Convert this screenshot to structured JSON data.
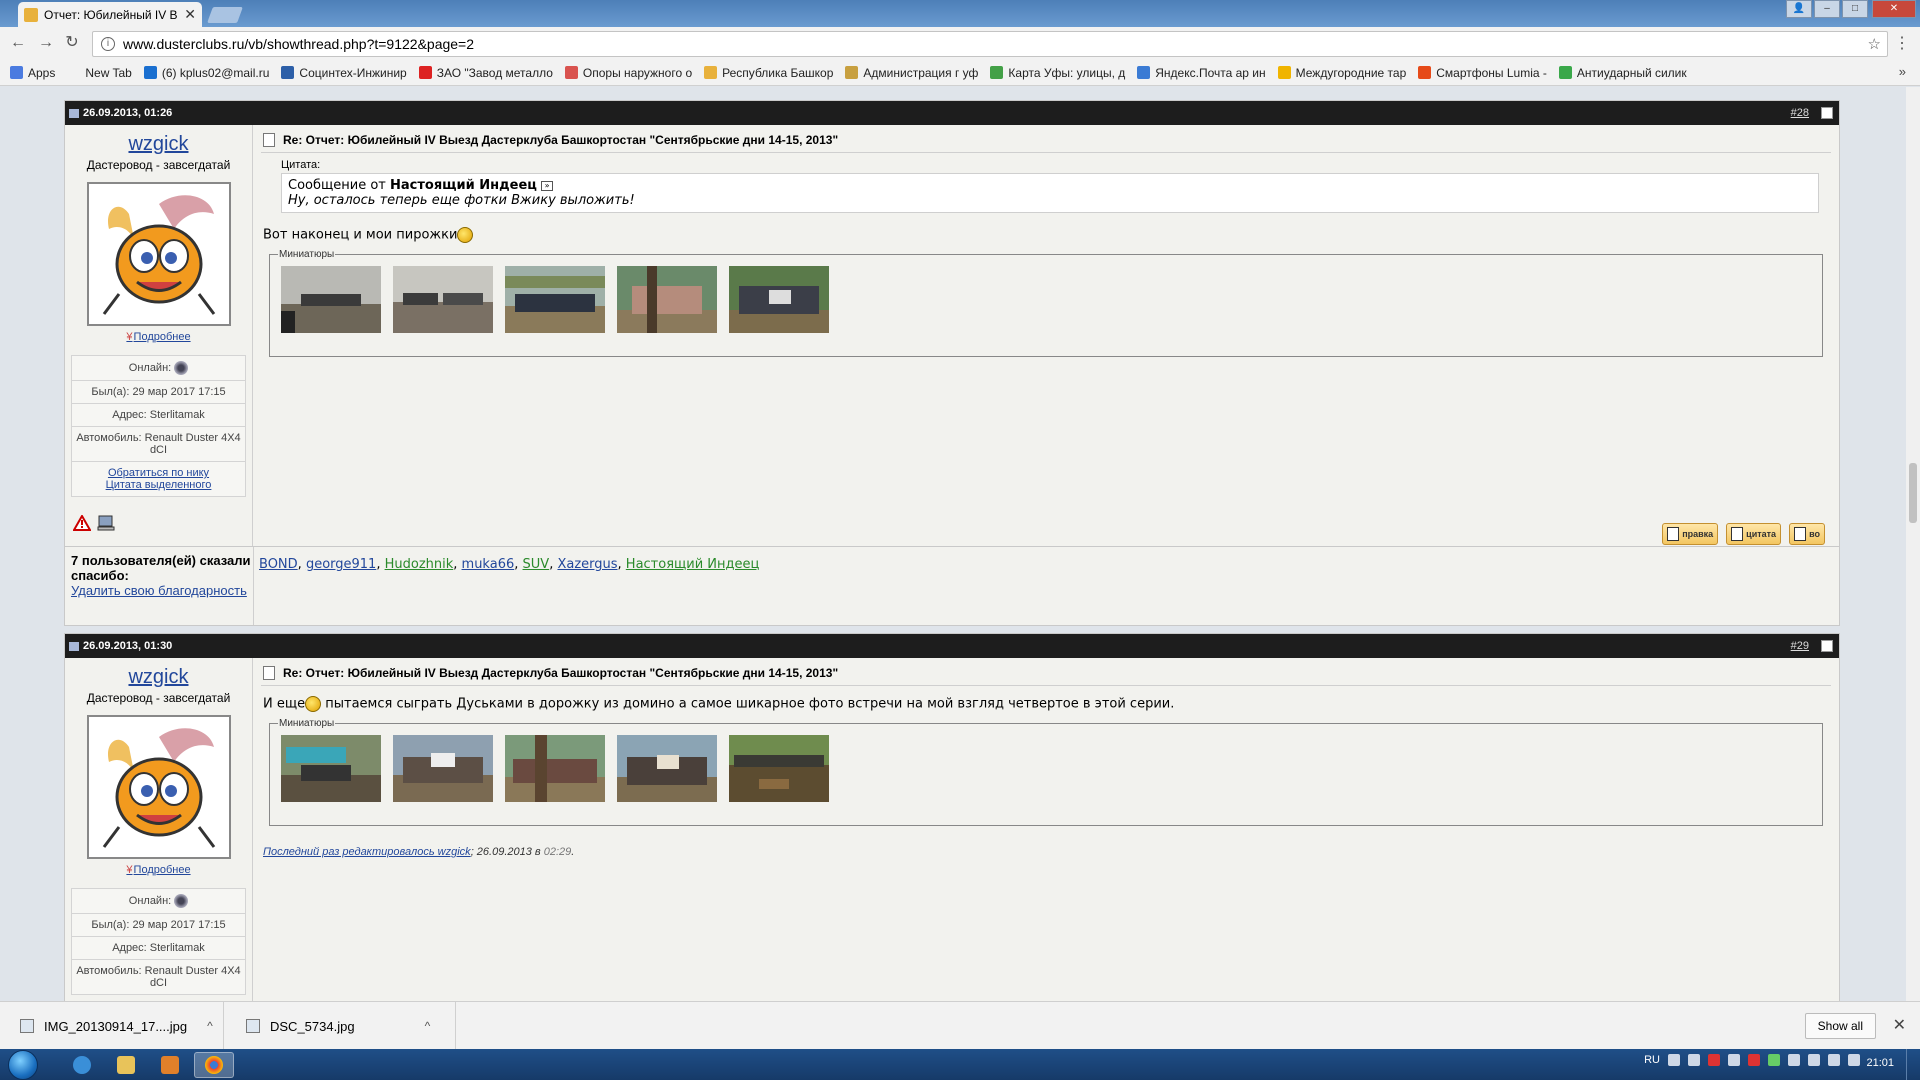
{
  "browser": {
    "tab_title": "Отчет: Юбилейный IV В",
    "url": "www.dusterclubs.ru/vb/showthread.php?t=9122&page=2",
    "bookmarks": [
      {
        "label": "Apps",
        "color": "#4b7be0"
      },
      {
        "label": "New Tab",
        "color": "#f2f2f2"
      },
      {
        "label": "(6) kplus02@mail.ru",
        "color": "#1a6fd0"
      },
      {
        "label": "Социнтех-Инжинир",
        "color": "#2d5fa8"
      },
      {
        "label": "ЗАО \"Завод металло",
        "color": "#d22"
      },
      {
        "label": "Опоры наружного о",
        "color": "#d9534f"
      },
      {
        "label": "Республика Башкор",
        "color": "#e8b13c"
      },
      {
        "label": "Администрация г уф",
        "color": "#c8a040"
      },
      {
        "label": "Карта Уфы: улицы, д",
        "color": "#43a047"
      },
      {
        "label": "Яндекс.Почта ар ин",
        "color": "#3b7bd4"
      },
      {
        "label": "Междугородние тар",
        "color": "#f0b400"
      },
      {
        "label": "Смартфоны Lumia -",
        "color": "#e64a19"
      },
      {
        "label": "Антиударный силик",
        "color": "#3aa84a"
      }
    ]
  },
  "posts": [
    {
      "date": "26.09.2013, 01:26",
      "number": "#28",
      "username": "wzgick",
      "user_title": "Дастеровод - завсегдатай",
      "more_label": "Подробнее",
      "online_label": "Онлайн:",
      "last_seen": "Был(а): 29 мар 2017 17:15",
      "address": "Адрес: Sterlitamak",
      "car": "Автомобиль: Renault Duster 4X4 dCI",
      "link1": "Обратиться по нику",
      "link2": "Цитата выделенного",
      "title": "Re: Отчет: Юбилейный IV Выезд Дастерклуба Башкортостан \"Сентябрьские дни 14-15, 2013\"",
      "quote_label": "Цитата:",
      "quote_prefix": "Сообщение от",
      "quote_author": "Настоящий Индеец",
      "quote_text": "Ну, осталось теперь еще фотки Вжику выложить!",
      "text": "Вот наконец и мои пирожки",
      "thumbs_label": "Миниатюры",
      "actions": [
        "правка",
        "цитата",
        "во"
      ]
    },
    {
      "date": "26.09.2013, 01:30",
      "number": "#29",
      "username": "wzgick",
      "user_title": "Дастеровод - завсегдатай",
      "more_label": "Подробнее",
      "online_label": "Онлайн:",
      "last_seen": "Был(а): 29 мар 2017 17:15",
      "address": "Адрес: Sterlitamak",
      "car": "Автомобиль: Renault Duster 4X4 dCI",
      "title": "Re: Отчет: Юбилейный IV Выезд Дастерклуба Башкортостан \"Сентябрьские дни 14-15, 2013\"",
      "text_before": "И еще",
      "text_after": " пытаемся сыграть Дуськами в дорожку из домино а самое шикарное фото встречи на мой взгляд четвертое в этой серии.",
      "thumbs_label": "Миниатюры",
      "edited_prefix": "Последний раз редактировалось wzgick",
      "edited_date": "; 26.09.2013 в ",
      "edited_time": "02:29",
      "edited_end": "."
    }
  ],
  "thanks": {
    "label": "7 пользователя(ей) сказали спасибо:",
    "remove_label": "Удалить свою благодарность",
    "names": [
      {
        "name": "BOND",
        "color": "blue"
      },
      {
        "name": "george911",
        "color": "blue"
      },
      {
        "name": "Hudozhnik",
        "color": "green"
      },
      {
        "name": "muka66",
        "color": "blue"
      },
      {
        "name": "SUV",
        "color": "green"
      },
      {
        "name": "Xazergus",
        "color": "blue"
      },
      {
        "name": "Настоящий Индеец",
        "color": "green"
      }
    ]
  },
  "downloads": {
    "items": [
      "IMG_20130914_17....jpg",
      "DSC_5734.jpg"
    ],
    "show_all": "Show all"
  },
  "taskbar": {
    "lang": "RU",
    "time": "21:01"
  }
}
